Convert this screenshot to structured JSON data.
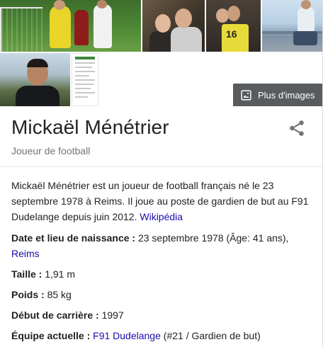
{
  "more_images": {
    "label": "Plus d'images",
    "icon": "image-icon"
  },
  "entity": {
    "name": "Mickaël Ménétrier",
    "subtitle": "Joueur de football",
    "share_icon": "share-icon"
  },
  "description": {
    "text": "Mickaël Ménétrier est un joueur de football français né le 23 septembre 1978 à Reims. Il joue au poste de gardien de but au F91 Dudelange depuis juin 2012. ",
    "source_link": "Wikipédia"
  },
  "facts": [
    {
      "label": "Date et lieu de naissance : ",
      "value": "23 septembre 1978 (Âge: 41 ans), ",
      "link": "Reims",
      "suffix": ""
    },
    {
      "label": "Taille : ",
      "value": "1,91 m",
      "link": "",
      "suffix": ""
    },
    {
      "label": "Poids : ",
      "value": "85 kg",
      "link": "",
      "suffix": ""
    },
    {
      "label": "Début de carrière : ",
      "value": "1997",
      "link": "",
      "suffix": ""
    },
    {
      "label": "Équipe actuelle : ",
      "value": "",
      "link": "F91 Dudelange",
      "suffix": " (#21 / Gardien de but)"
    }
  ],
  "images": {
    "shirt_number": "16"
  },
  "colors": {
    "link": "#1a0dab",
    "overlay": "#3c4043"
  }
}
